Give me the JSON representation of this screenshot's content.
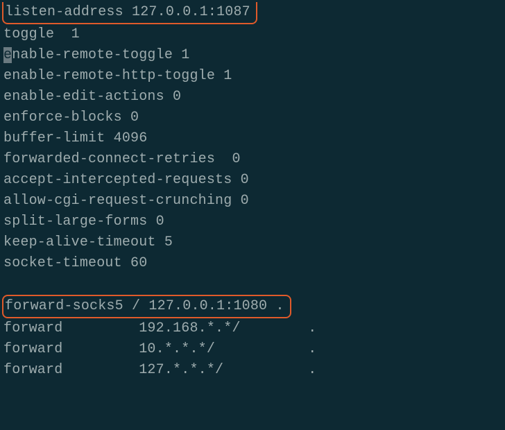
{
  "config": {
    "listen_address": "listen-address 127.0.0.1:1087",
    "toggle": "toggle  1",
    "enable_remote_toggle_cursor": "e",
    "enable_remote_toggle_rest": "nable-remote-toggle 1",
    "enable_remote_http_toggle": "enable-remote-http-toggle 1",
    "enable_edit_actions": "enable-edit-actions 0",
    "enforce_blocks": "enforce-blocks 0",
    "buffer_limit": "buffer-limit 4096",
    "forwarded_connect_retries": "forwarded-connect-retries  0",
    "accept_intercepted_requests": "accept-intercepted-requests 0",
    "allow_cgi_request_crunching": "allow-cgi-request-crunching 0",
    "split_large_forms": "split-large-forms 0",
    "keep_alive_timeout": "keep-alive-timeout 5",
    "socket_timeout": "socket-timeout 60",
    "forward_socks5": "forward-socks5 / 127.0.0.1:1080 .",
    "forward_1": "forward         192.168.*.*/        .",
    "forward_2": "forward         10.*.*.*/           .",
    "forward_3": "forward         127.*.*.*/          ."
  }
}
